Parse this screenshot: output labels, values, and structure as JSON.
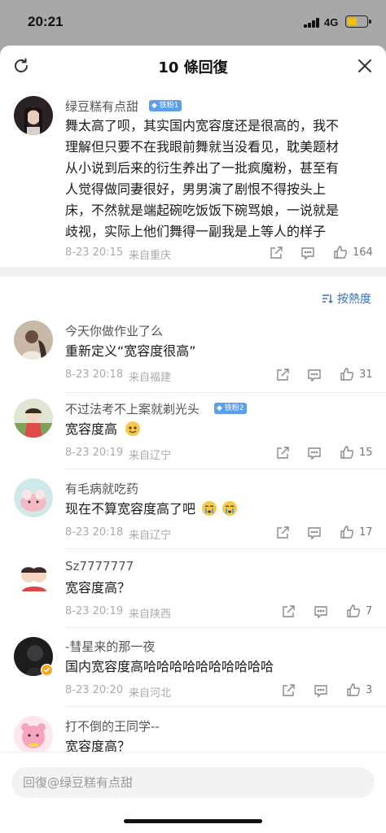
{
  "status_bar": {
    "time": "20:21",
    "network": "4G",
    "battery_level": 0.5
  },
  "header": {
    "title": "10 條回復"
  },
  "main_comment": {
    "user": "绿豆糕有点甜",
    "badge": "铁粉1",
    "lines": [
      "舞太高了呗，其实国内宽容度还是很高的，我不",
      "理解但只要不在我眼前舞就当没看见，耽美题材",
      "从小说到后来的衍生养出了一批疯魔粉，甚至有",
      "人觉得做同妻很好，男男演了剧恨不得按头上",
      "床，不然就是端起碗吃饭饭下碗骂娘，一说就是",
      "歧视，实际上他们舞得一副我是上等人的样子"
    ],
    "time": "8-23 20:15",
    "location": "来自重庆",
    "likes": "164"
  },
  "sort_label": "按熱度",
  "replies": [
    {
      "user": "今天你做作业了么",
      "text": "重新定义“宽容度很高”",
      "time": "8-23 20:18",
      "location": "来自福建",
      "likes": "31"
    },
    {
      "user": "不过法考不上案就剃光头",
      "badge": "铁粉2",
      "text": "宽容度高",
      "time": "8-23 20:19",
      "location": "来自辽宁",
      "likes": "15"
    },
    {
      "user": "有毛病就吃药",
      "text": "现在不算宽容度高了吧",
      "time": "8-23 20:18",
      "location": "来自辽宁",
      "likes": "17"
    },
    {
      "user": "Sz7777777",
      "text": "宽容度高？",
      "time": "8-23 20:19",
      "location": "来自陕西",
      "likes": "7"
    },
    {
      "user": "-彗星来的那一夜",
      "text": "国内宽容度高哈哈哈哈哈哈哈哈哈哈",
      "time": "8-23 20:20",
      "location": "来自河北",
      "likes": "3"
    },
    {
      "user": "打不倒的王同学--",
      "text": "宽容度高？"
    }
  ],
  "reply_bar": {
    "placeholder": "回復@绿豆糕有点甜"
  },
  "colors": {
    "accent": "#3e6db5",
    "badge": "#5b9eec",
    "battery": "#f2c200"
  }
}
